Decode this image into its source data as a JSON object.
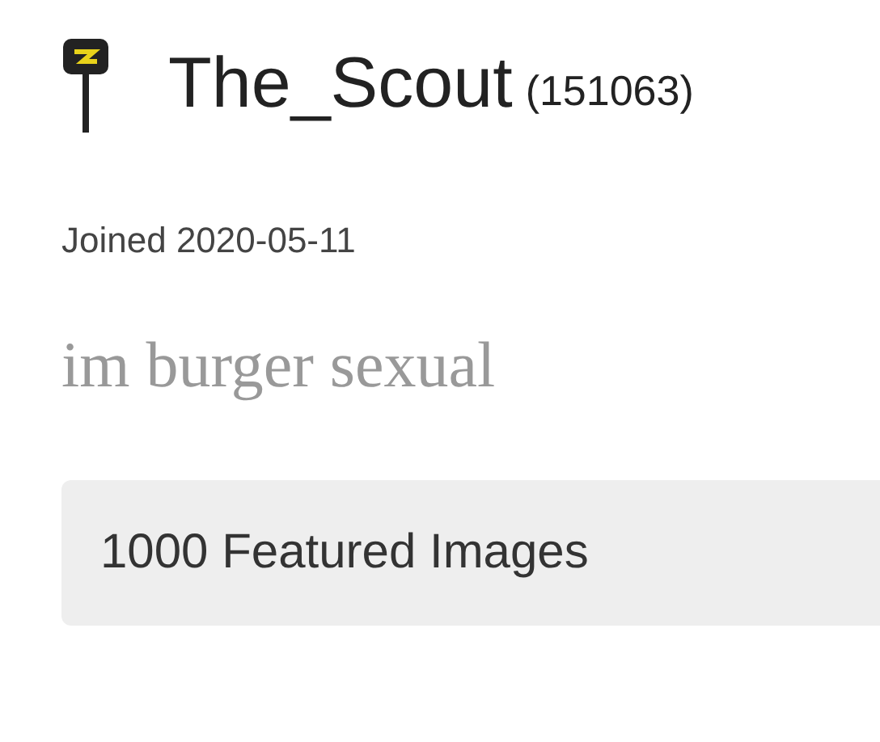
{
  "user": {
    "name": "The_Scout",
    "points": "(151063)"
  },
  "joined": "Joined 2020-05-11",
  "bio": "im burger sexual",
  "featured": "1000 Featured Images"
}
